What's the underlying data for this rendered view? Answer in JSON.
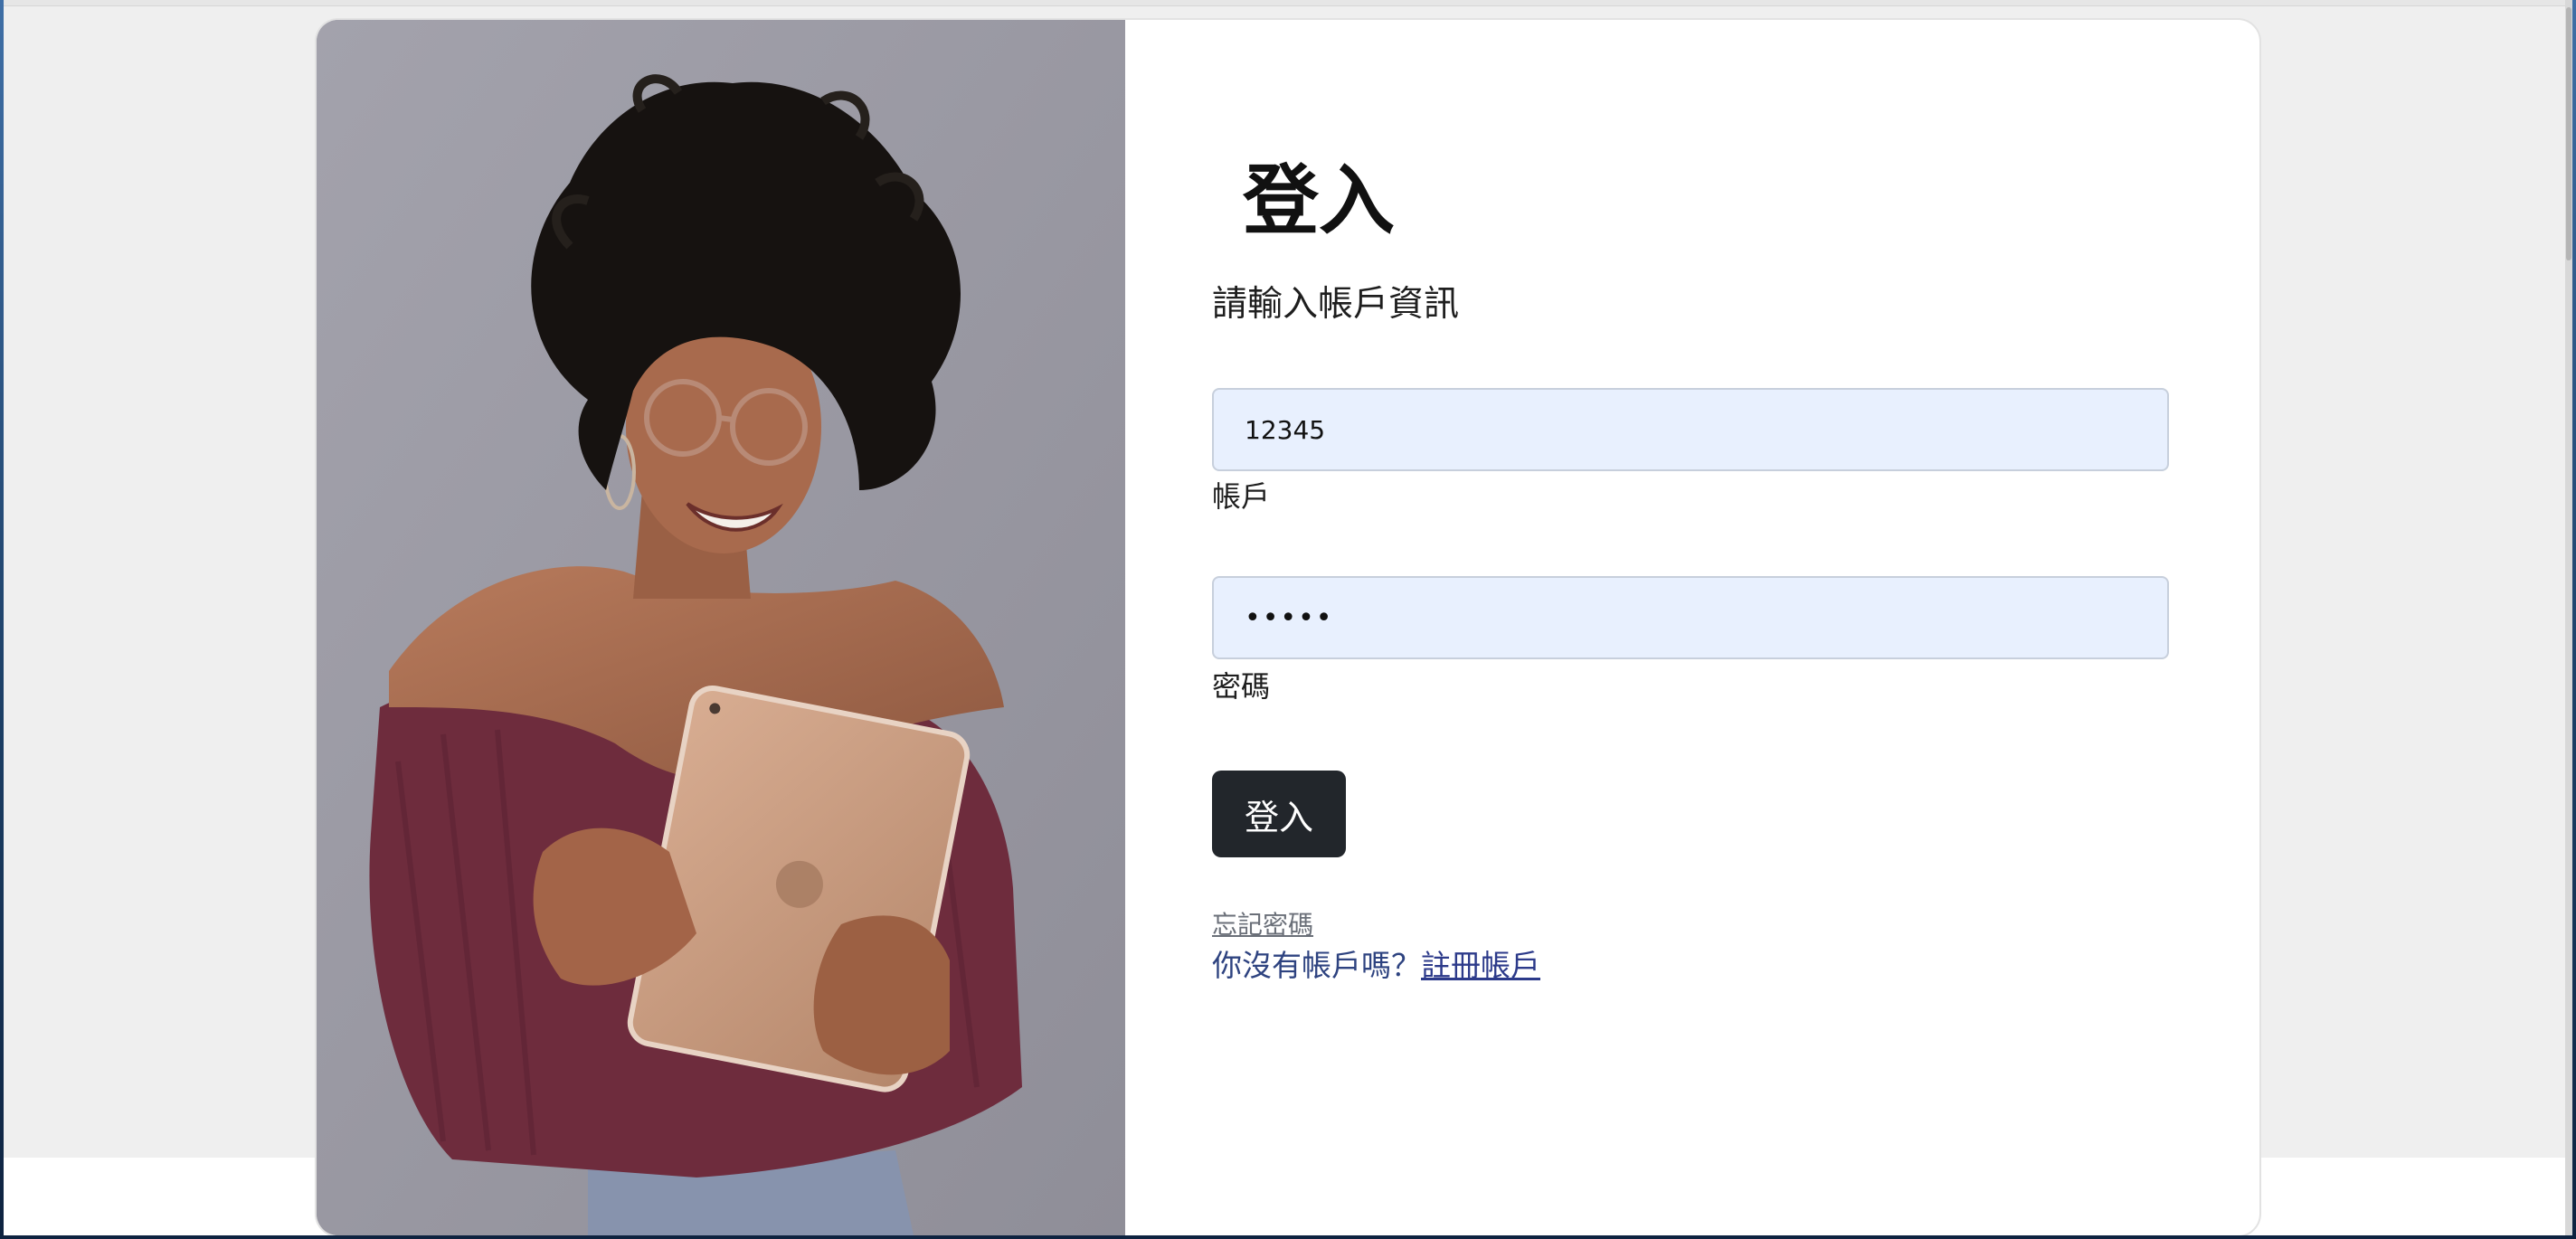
{
  "login": {
    "title": "登入",
    "subtitle": "請輸入帳戶資訊",
    "account": {
      "value": "12345",
      "label": "帳戶"
    },
    "password": {
      "value": "12345",
      "label": "密碼"
    },
    "submit_label": "登入",
    "forgot_password": "忘記密碼",
    "register_prompt": "你沒有帳戶嗎？",
    "register_link": "註冊帳戶"
  },
  "colors": {
    "page_background": "#efefef",
    "input_background": "#e8f0fe",
    "button_background": "#22262b",
    "link": "#2c3a8a"
  },
  "photo": {
    "icon": "woman-with-tablet-photo"
  }
}
